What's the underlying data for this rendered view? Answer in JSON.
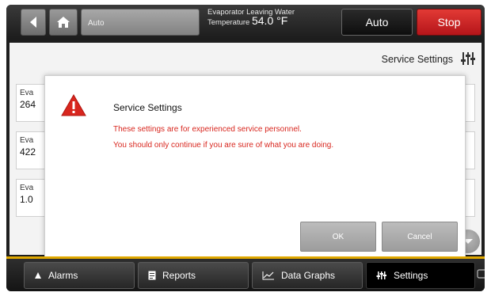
{
  "topbar": {
    "mode_field": "Auto",
    "temperature": {
      "label_line1": "Evaporator Leaving Water",
      "label_line2": "Temperature",
      "value": "54.0 °F"
    },
    "auto_label": "Auto",
    "stop_label": "Stop"
  },
  "page": {
    "title": "Service Settings",
    "background_items": [
      {
        "label": "Eva",
        "value": "264"
      },
      {
        "label": "Eva",
        "value": "422"
      },
      {
        "label": "Eva",
        "value": "1.0"
      }
    ]
  },
  "dialog": {
    "title": "Service Settings",
    "message_line1": "These settings are for experienced service personnel.",
    "message_line2": "You should only continue if you are sure of what you are doing.",
    "ok_label": "OK",
    "cancel_label": "Cancel"
  },
  "bottom_nav": [
    {
      "label": "Alarms",
      "icon": "bell-icon"
    },
    {
      "label": "Reports",
      "icon": "report-icon"
    },
    {
      "label": "Data Graphs",
      "icon": "line-chart-icon"
    },
    {
      "label": "Settings",
      "icon": "sliders-icon",
      "active": true
    }
  ],
  "colors": {
    "stop": "#c91d1f",
    "warning": "#d8261e",
    "accent_line": "#e0a800"
  }
}
